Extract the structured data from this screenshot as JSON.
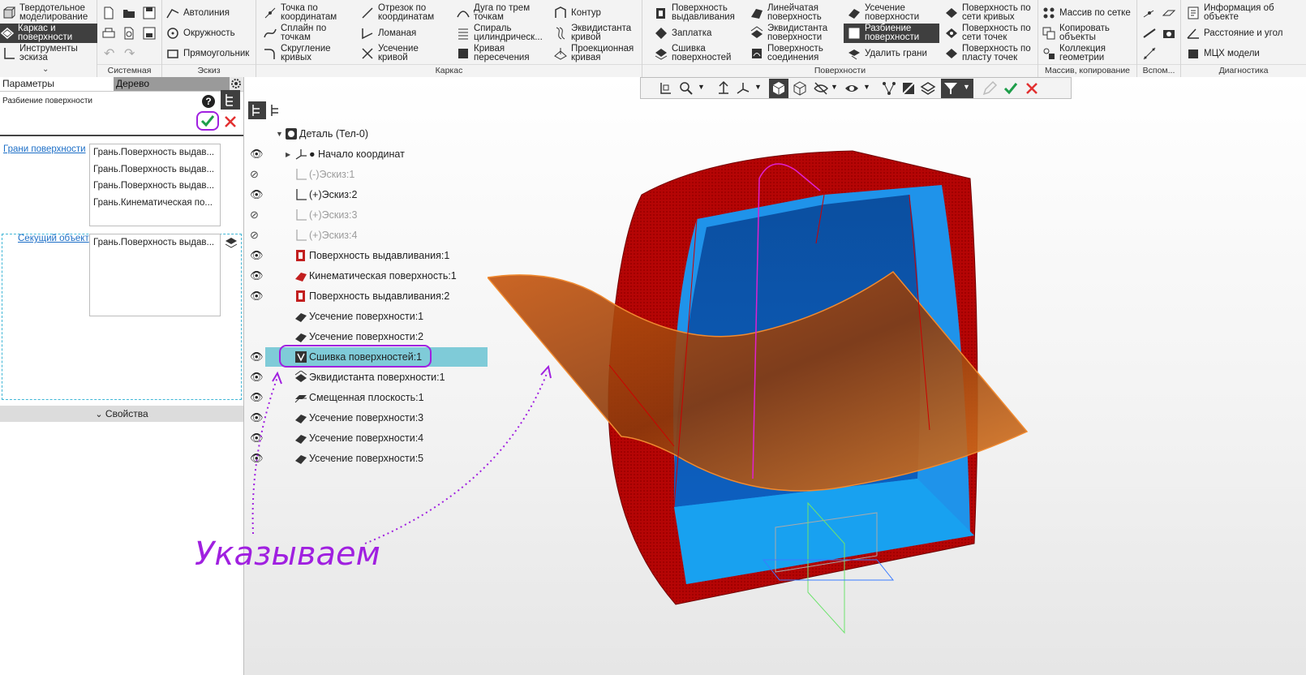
{
  "ribbon": {
    "groups": [
      {
        "title": ""
      },
      {
        "title": "Системная"
      },
      {
        "title": "Эскиз"
      },
      {
        "title": "Каркас"
      },
      {
        "title": "Поверхности"
      },
      {
        "title": "Массив, копирование"
      },
      {
        "title": "Вспом..."
      },
      {
        "title": "Диагностика"
      }
    ],
    "mode_buttons": [
      {
        "label": "Твердотельное моделирование"
      },
      {
        "label": "Каркас и поверхности"
      },
      {
        "label": "Инструменты эскиза"
      }
    ],
    "sketch": [
      {
        "label": "Автолиния"
      },
      {
        "label": "Окружность"
      },
      {
        "label": "Прямоугольник"
      }
    ],
    "frame": [
      {
        "label": "Точка по координатам"
      },
      {
        "label": "Сплайн по точкам"
      },
      {
        "label": "Скругление кривых"
      },
      {
        "label": "Отрезок по координатам"
      },
      {
        "label": "Ломаная"
      },
      {
        "label": "Усечение кривой"
      },
      {
        "label": "Дуга по трем точкам"
      },
      {
        "label": "Спираль цилиндрическ..."
      },
      {
        "label": "Кривая пересечения"
      },
      {
        "label": "Контур"
      },
      {
        "label": "Эквидистанта кривой"
      },
      {
        "label": "Проекционная кривая"
      }
    ],
    "surfaces": [
      {
        "label": "Поверхность выдавливания"
      },
      {
        "label": "Заплатка"
      },
      {
        "label": "Сшивка поверхностей"
      },
      {
        "label": "Линейчатая поверхность"
      },
      {
        "label": "Эквидистанта поверхности"
      },
      {
        "label": "Поверхность соединения"
      },
      {
        "label": "Усечение поверхности"
      },
      {
        "label": "Разбиение поверхности"
      },
      {
        "label": "Удалить грани"
      },
      {
        "label": "Поверхность по сети кривых"
      },
      {
        "label": "Поверхность по сети точек"
      },
      {
        "label": "Поверхность по пласту точек"
      }
    ],
    "array": [
      {
        "label": "Массив по сетке"
      },
      {
        "label": "Копировать объекты"
      },
      {
        "label": "Коллекция геометрии"
      }
    ],
    "diag": [
      {
        "label": "Информация об объекте"
      },
      {
        "label": "Расстояние и угол"
      },
      {
        "label": "МЦХ модели"
      }
    ]
  },
  "panel": {
    "tab_params": "Параметры",
    "tab_tree": "Дерево",
    "operation": "Разбиение поверхности",
    "faces_label": "Грани поверхности",
    "faces": [
      "Грань.Поверхность выдав...",
      "Грань.Поверхность выдав...",
      "Грань.Поверхность выдав...",
      "Грань.Кинематическая по..."
    ],
    "cutter_label": "Секущий объект",
    "cutter": [
      "Грань.Поверхность выдав..."
    ],
    "properties": "Свойства"
  },
  "tree": {
    "items": [
      {
        "label": "Деталь (Тел-0)"
      },
      {
        "label": "Начало координат"
      },
      {
        "label": "(-)Эскиз:1"
      },
      {
        "label": "(+)Эскиз:2"
      },
      {
        "label": "(+)Эскиз:3"
      },
      {
        "label": "(+)Эскиз:4"
      },
      {
        "label": "Поверхность выдавливания:1"
      },
      {
        "label": "Кинематическая поверхность:1"
      },
      {
        "label": "Поверхность выдавливания:2"
      },
      {
        "label": "Усечение поверхности:1"
      },
      {
        "label": "Усечение поверхности:2"
      },
      {
        "label": "Сшивка поверхностей:1"
      },
      {
        "label": "Эквидистанта поверхности:1"
      },
      {
        "label": "Смещенная плоскость:1"
      },
      {
        "label": "Усечение поверхности:3"
      },
      {
        "label": "Усечение поверхности:4"
      },
      {
        "label": "Усечение поверхности:5"
      }
    ]
  },
  "annotation": "Указываем",
  "colors": {
    "accent_purple": "#a020e0",
    "model_red": "#b30000",
    "model_blue": "#1e8fe8",
    "cut_orange": "#d86a18",
    "selection": "#7fcbd8"
  }
}
